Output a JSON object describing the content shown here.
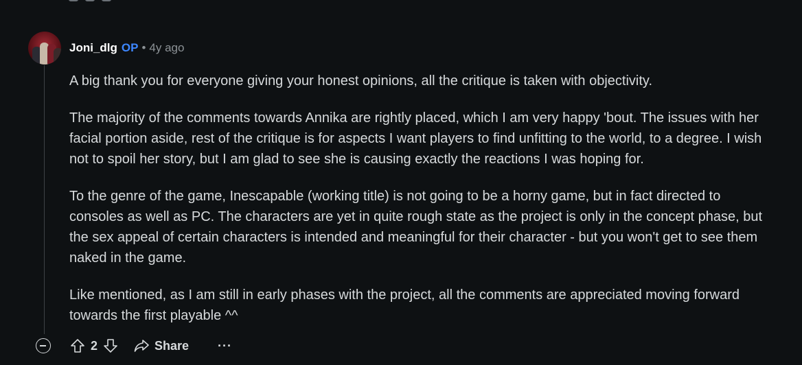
{
  "comment": {
    "author": "Joni_dlg",
    "op_badge": "OP",
    "separator": "•",
    "age": "4y ago",
    "avatar_icon": "avatar-image-icon",
    "paragraphs": [
      "A big thank you for everyone giving your honest opinions, all the critique is taken with objectivity.",
      "The majority of the comments towards Annika are rightly placed, which I am very happy 'bout. The issues with her facial portion aside, rest of the critique is for aspects I want players to find unfitting to the world, to a degree. I wish not to spoil her story, but I am glad to see she is causing exactly the reactions I was hoping for.",
      "To the genre of the game, Inescapable (working title) is not going to be a horny game, but in fact directed to consoles as well as PC. The characters are yet in quite rough state as the project is only in the concept phase, but the sex appeal of certain characters is intended and meaningful for their character - but you won't get to see them naked in the game.",
      "Like mentioned, as I am still in early phases with the project, all the comments are appreciated moving forward towards the first playable ^^"
    ]
  },
  "actions": {
    "score": "2",
    "share_label": "Share",
    "more_label": "···",
    "icons": {
      "collapse": "collapse-circle-icon",
      "upvote": "arrow-up-icon",
      "downvote": "arrow-down-icon",
      "share": "share-arrow-icon",
      "more": "more-dots-icon"
    }
  },
  "colors": {
    "background": "#0e1113",
    "text": "#d7dadc",
    "muted": "#8c9296",
    "op_badge": "#3d87ff",
    "thread_line": "#3e4346"
  }
}
